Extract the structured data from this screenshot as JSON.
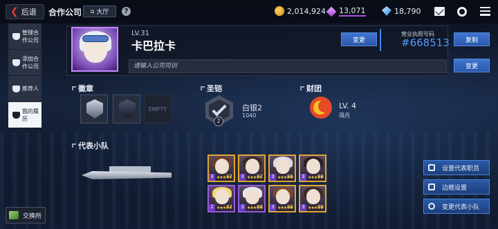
{
  "topbar": {
    "back_label": "后退",
    "title": "合作公司",
    "lobby_label": "大厅",
    "help": "?",
    "gold": "2,014,924",
    "crystal": "13,071",
    "diamond": "18,790"
  },
  "sidebar": {
    "items": [
      {
        "label": "管理合作公司"
      },
      {
        "label": "添加合作公司"
      },
      {
        "label": "推荐人"
      },
      {
        "label": "我的履历"
      }
    ],
    "exchange_label": "交换所"
  },
  "profile": {
    "level": "LV.31",
    "name": "卡巴拉卡",
    "motto_placeholder": "请输入公司司训",
    "change_name_label": "变更",
    "license_label": "营业执照号码",
    "license_number": "#668513",
    "copy_label": "复制",
    "change_motto_label": "变更"
  },
  "sections": {
    "badge_title": "徽章",
    "badge_empty": "EMPTY",
    "armor_title": "圣铠",
    "armor_rank": "白银2",
    "armor_points": "1040",
    "armor_level": "2",
    "corp_title": "财团",
    "corp_level": "LV. 4",
    "corp_name": "瑀月",
    "team_title": "代表小队"
  },
  "team": [
    {
      "lv": "97",
      "rank": "3",
      "hair": "#6b3d24",
      "border": "gold"
    },
    {
      "lv": "97",
      "rank": "3",
      "hair": "#3a2a22",
      "border": "gold"
    },
    {
      "lv": "96",
      "rank": "3",
      "hair": "#d9dde6",
      "border": "gold"
    },
    {
      "lv": "96",
      "rank": "3",
      "hair": "#2a2024",
      "border": "gold"
    },
    {
      "lv": "97",
      "rank": "2",
      "hair": "#f2d77a",
      "border": "purple"
    },
    {
      "lv": "98",
      "rank": "3",
      "hair": "#e6e8ee",
      "border": "purple"
    },
    {
      "lv": "98",
      "rank": "3",
      "hair": "#7a4a26",
      "border": "gold"
    },
    {
      "lv": "98",
      "rank": "3",
      "hair": "#3b2a20",
      "border": "gold"
    }
  ],
  "team_stars": "★★★★★",
  "right_buttons": {
    "set_member": "设置代表职员",
    "set_frame": "边框设置",
    "change_team": "变更代表小队"
  }
}
